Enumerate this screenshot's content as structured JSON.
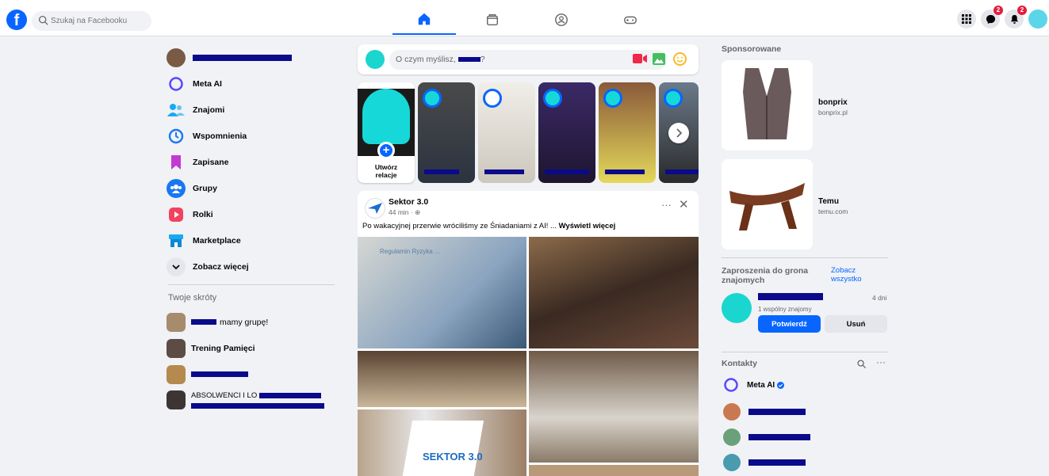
{
  "search": {
    "placeholder": "Szukaj na Facebooku"
  },
  "notifications": {
    "messenger_count": "2",
    "bell_count": "2"
  },
  "left_nav": [
    {
      "label": "Meta AI",
      "icon": "meta-ai-icon"
    },
    {
      "label": "Znajomi",
      "icon": "friends-icon"
    },
    {
      "label": "Wspomnienia",
      "icon": "memories-icon"
    },
    {
      "label": "Zapisane",
      "icon": "saved-icon"
    },
    {
      "label": "Grupy",
      "icon": "groups-icon"
    },
    {
      "label": "Rolki",
      "icon": "reels-icon"
    },
    {
      "label": "Marketplace",
      "icon": "marketplace-icon"
    },
    {
      "label": "Zobacz więcej",
      "icon": "chevron-down-icon"
    }
  ],
  "shortcuts": {
    "title": "Twoje skróty",
    "items": [
      {
        "label": "mamy grupę!"
      },
      {
        "label": "Trening Pamięci"
      },
      {
        "label": ""
      },
      {
        "label": "ABSOLWENCI I LO"
      }
    ]
  },
  "composer": {
    "placeholder": "O czym myślisz,",
    "suffix": "?"
  },
  "stories": {
    "create_label_1": "Utwórz",
    "create_label_2": "relacje"
  },
  "post": {
    "author": "Sektor 3.0",
    "time": "44 min ·",
    "text": "Po wakacyjnej przerwie wróciliśmy ze Śniadaniami z AI! ...",
    "more": "Wyświetl więcej",
    "slide_title": "Regulamin Ryzyka ...",
    "banner_text": "SEKTOR 3.0"
  },
  "sponsored": {
    "title": "Sponsorowane",
    "ads": [
      {
        "name": "bonprix",
        "url": "bonprix.pl"
      },
      {
        "name": "Temu",
        "url": "temu.com"
      }
    ]
  },
  "friend_requests": {
    "title": "Zaproszenia do grona znajomych",
    "see_all": "Zobacz wszystko",
    "time": "4 dni",
    "mutual": "1 wspólny znajomy",
    "confirm": "Potwierdź",
    "delete": "Usuń"
  },
  "contacts": {
    "title": "Kontakty",
    "items": [
      {
        "name": "Meta AI"
      }
    ]
  },
  "colors": {
    "brand": "#0866ff",
    "badge": "#e41e3f",
    "redaction": "#0a0a8a"
  }
}
